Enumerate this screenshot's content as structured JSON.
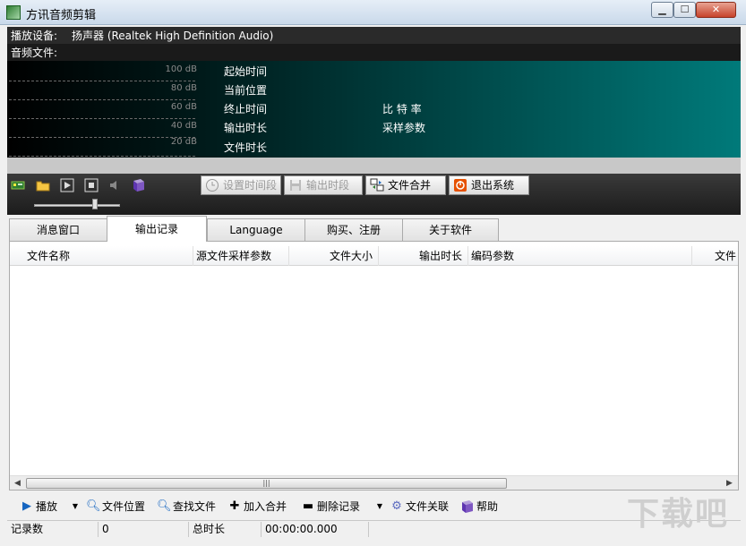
{
  "window": {
    "title": "方讯音频剪辑"
  },
  "info": {
    "device_label": "播放设备:",
    "device_value": "扬声器 (Realtek High Definition Audio)",
    "file_label": "音频文件:"
  },
  "meter": {
    "db_labels": [
      "100 dB",
      "80 dB",
      "60 dB",
      "40 dB",
      "20 dB"
    ]
  },
  "fields": {
    "start_time": "起始时间",
    "current_pos": "当前位置",
    "end_time": "终止时间",
    "output_duration": "输出时长",
    "file_duration": "文件时长",
    "bitrate": "比 特 率",
    "sample_params": "采样参数"
  },
  "toolbar": {
    "set_range": "设置时间段",
    "output_range": "输出时段",
    "merge_files": "文件合并",
    "exit_system": "退出系统",
    "volume_level": 0.72
  },
  "tabs": [
    "消息窗口",
    "输出记录",
    "Language",
    "购买、注册",
    "关于软件"
  ],
  "list": {
    "columns": [
      "文件名称",
      "源文件采样参数",
      "文件大小",
      "输出时长",
      "编码参数",
      "文件"
    ]
  },
  "bottom": {
    "play": "播放",
    "file_location": "文件位置",
    "find_file": "查找文件",
    "add_merge": "加入合并",
    "delete_record": "删除记录",
    "file_assoc": "文件关联",
    "help": "帮助"
  },
  "status": {
    "count_label": "记录数",
    "count_value": "0",
    "total_label": "总时长",
    "total_value": "00:00:00.000"
  },
  "colors": {
    "accent": "#007a7a",
    "panel_dark": "#1c1c1c"
  }
}
